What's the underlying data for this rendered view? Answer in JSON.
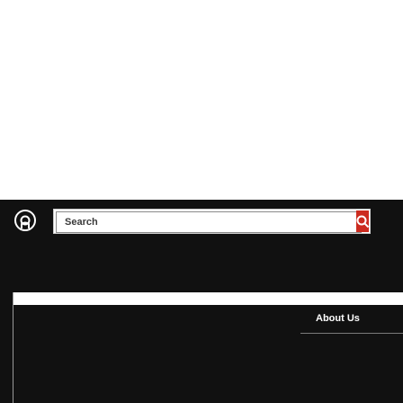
{
  "header": {
    "logo_icon": "ring-logo-icon",
    "search": {
      "value": "Search",
      "button_icon": "search-icon",
      "accent": "#cc2b1f"
    }
  },
  "footer": {
    "about_title": "About Us"
  },
  "colors": {
    "background": "#ffffff",
    "header": "#111111",
    "accent": "#cc2b1f"
  }
}
